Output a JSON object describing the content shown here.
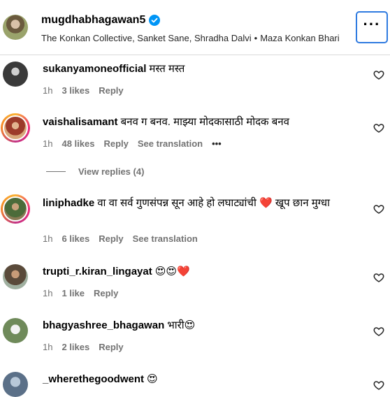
{
  "header": {
    "username": "mugdhabhagawan5",
    "collaborators": "The Konkan Collective, Sanket Sane, Shradha Dalvi",
    "audio": "Maza Konkan Bhari",
    "more_label": "···"
  },
  "view_replies": "View replies (4)",
  "comments": [
    {
      "username": "sukanyamoneofficial",
      "text": "मस्त मस्त",
      "time": "1h",
      "likes": "3 likes",
      "reply": "Reply",
      "translation": ""
    },
    {
      "username": "vaishalisamant",
      "text": "बनव ग बनव. माझ्या मोदकासाठी मोदक बनव",
      "time": "1h",
      "likes": "48 likes",
      "reply": "Reply",
      "translation": "See translation",
      "more": "•••"
    },
    {
      "username": "liniphadke",
      "text": "वा वा सर्व गुणसंपन्न सून आहे हो लघाट्यांची ❤️ खूप छान मुग्धा",
      "time": "1h",
      "likes": "6 likes",
      "reply": "Reply",
      "translation": "See translation"
    },
    {
      "username": "trupti_r.kiran_lingayat",
      "text": "😍😍❤️",
      "time": "1h",
      "likes": "1 like",
      "reply": "Reply"
    },
    {
      "username": "bhagyashree_bhagawan",
      "text": "भारी😍",
      "time": "1h",
      "likes": "2 likes",
      "reply": "Reply"
    },
    {
      "username": "_wherethegoodwent",
      "text": "😍"
    }
  ],
  "colors": {
    "accent": "#2f7be0",
    "verified": "#0095f6",
    "meta": "#737373",
    "divider": "#dbdbdb"
  }
}
